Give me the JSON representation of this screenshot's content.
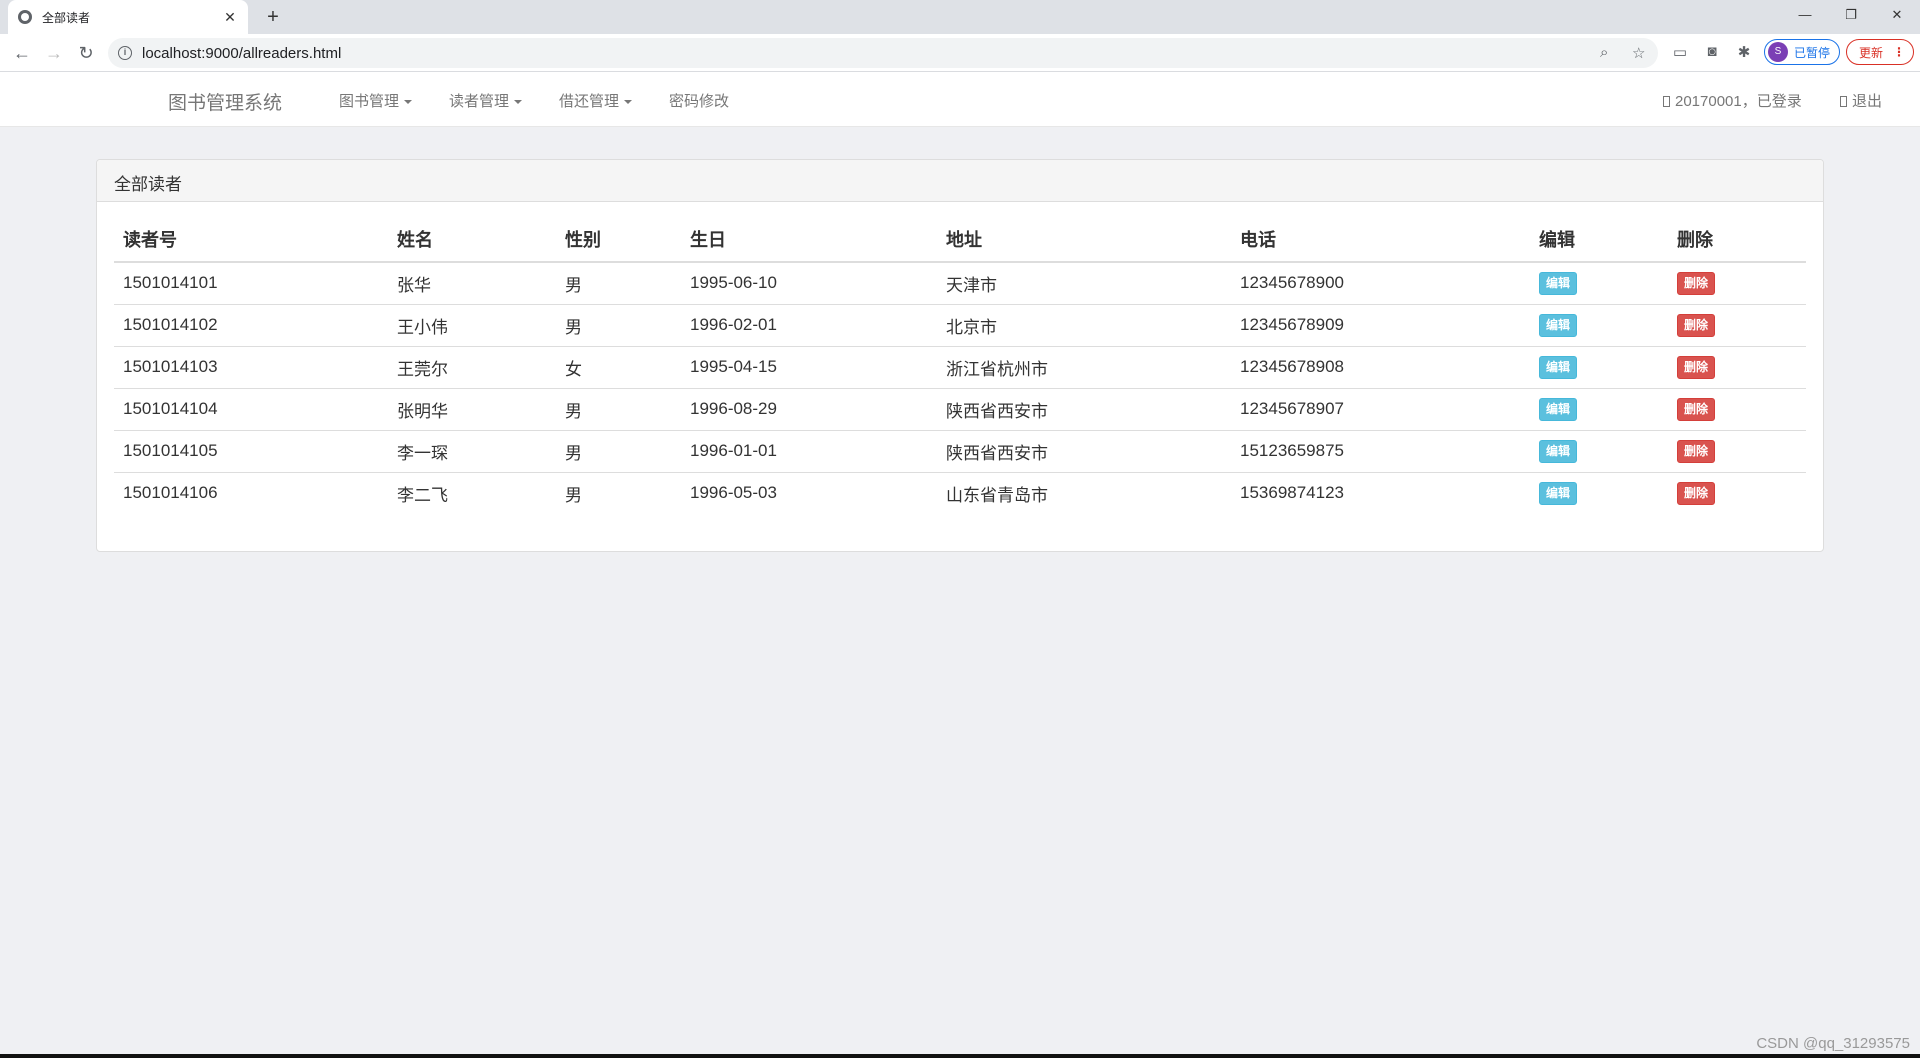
{
  "browser": {
    "tab_title": "全部读者",
    "tab_close": "✕",
    "new_tab": "+",
    "url": "localhost:9000/allreaders.html",
    "profile_initial": "S",
    "profile_label": "已暂停",
    "update_label": "更新",
    "update_menu": "⋮",
    "win_min": "—",
    "win_restore": "❐",
    "win_close": "✕",
    "back": "←",
    "forward": "→",
    "reload": "↻"
  },
  "navbar": {
    "brand": "图书管理系统",
    "menus": [
      "图书管理",
      "读者管理",
      "借还管理",
      "密码修改"
    ],
    "user": "20170001，已登录",
    "logout": "退出"
  },
  "panel": {
    "title": "全部读者"
  },
  "table": {
    "headers": [
      "读者号",
      "姓名",
      "性别",
      "生日",
      "地址",
      "电话",
      "编辑",
      "删除"
    ],
    "edit_label": "编辑",
    "delete_label": "删除",
    "rows": [
      {
        "id": "1501014101",
        "name": "张华",
        "gender": "男",
        "birthday": "1995-06-10",
        "address": "天津市",
        "phone": "12345678900"
      },
      {
        "id": "1501014102",
        "name": "王小伟",
        "gender": "男",
        "birthday": "1996-02-01",
        "address": "北京市",
        "phone": "12345678909"
      },
      {
        "id": "1501014103",
        "name": "王莞尔",
        "gender": "女",
        "birthday": "1995-04-15",
        "address": "浙江省杭州市",
        "phone": "12345678908"
      },
      {
        "id": "1501014104",
        "name": "张明华",
        "gender": "男",
        "birthday": "1996-08-29",
        "address": "陕西省西安市",
        "phone": "12345678907"
      },
      {
        "id": "1501014105",
        "name": "李一琛",
        "gender": "男",
        "birthday": "1996-01-01",
        "address": "陕西省西安市",
        "phone": "15123659875"
      },
      {
        "id": "1501014106",
        "name": "李二飞",
        "gender": "男",
        "birthday": "1996-05-03",
        "address": "山东省青岛市",
        "phone": "15369874123"
      }
    ]
  },
  "watermark": "CSDN @qq_31293575"
}
